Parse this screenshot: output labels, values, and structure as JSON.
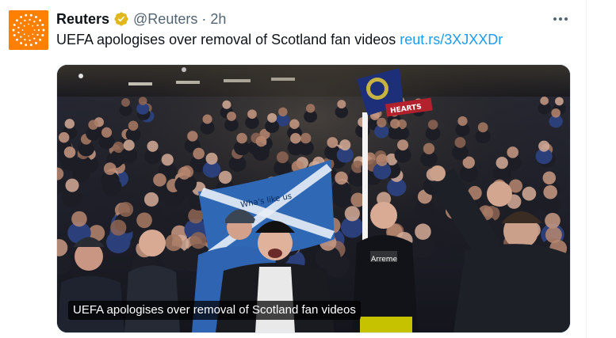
{
  "tweet": {
    "author_name": "Reuters",
    "handle": "@Reuters",
    "separator": "·",
    "time": "2h",
    "text": "UEFA apologises over removal of Scotland fan videos",
    "link_text": "reut.rs/3XJXXDr",
    "media_caption": "UEFA apologises over removal of Scotland fan videos",
    "icons": {
      "verified": "verified-badge-icon",
      "more": "more-options-icon",
      "avatar": "reuters-logo"
    }
  },
  "colors": {
    "brand": "#ff8000",
    "verified": "#e2b719",
    "link": "#1d9bf0",
    "text": "#0f1419",
    "muted": "#536471"
  },
  "media_scene": {
    "flag_text": "Wha's like us",
    "scarf_text": "HEARTS",
    "shirt_text": "Arreme"
  }
}
